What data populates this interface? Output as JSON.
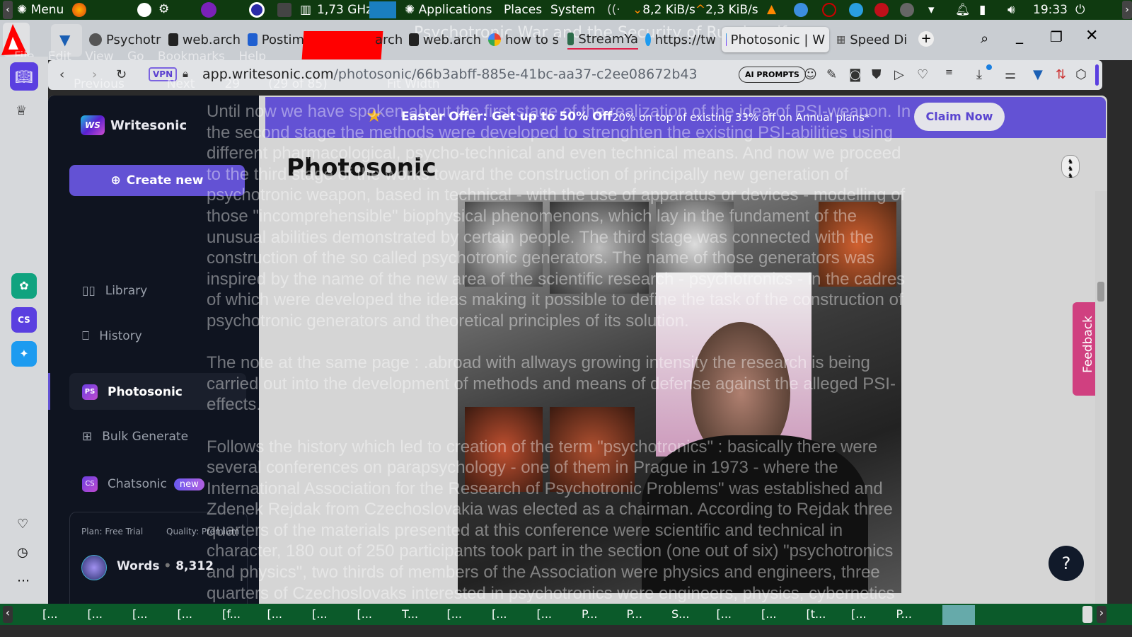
{
  "top_panel": {
    "menu": "Menu",
    "cpu": "1,73 GHz",
    "applications": "Applications",
    "places": "Places",
    "system": "System",
    "net_down": "8,2 KiB/s",
    "net_up": "2,3 KiB/s",
    "clock": "19:33"
  },
  "window_title_ghost": "Psychotronic War and the Security of Russia.pdf",
  "pdf_menu_ghost": [
    "File",
    "Edit",
    "View",
    "Go",
    "Bookmarks",
    "Help"
  ],
  "pdf_toolbar_ghost": {
    "previous": "Previous",
    "next": "Next",
    "page": "29",
    "page_of": "(29 of 85)",
    "zoom": "Fit Width"
  },
  "tabs": [
    {
      "label": "Psychotr"
    },
    {
      "label": "web.arch"
    },
    {
      "label": "Postim"
    },
    {
      "label": "arch"
    },
    {
      "label": "web.arch"
    },
    {
      "label": "how to s"
    },
    {
      "label": "StreamYa"
    },
    {
      "label": "https://tw"
    },
    {
      "label": "Photosonic | W",
      "active": true
    },
    {
      "label": "Speed Di"
    }
  ],
  "address": {
    "vpn": "VPN",
    "host": "app.writesonic.com",
    "path": "/photosonic/66b3abff-885e-41bc-aa37-c2ee08672b43",
    "ai_prompts": "AI PROMPTS"
  },
  "app": {
    "brand": "Writesonic",
    "logo_text": "WS",
    "create_new": "Create new",
    "nav": [
      {
        "label": "Library"
      },
      {
        "label": "History"
      },
      {
        "label": "Photosonic",
        "active": true
      },
      {
        "label": "Bulk Generate"
      },
      {
        "label": "Chatsonic",
        "badge": "new"
      }
    ],
    "plan": "Plan: Free Trial",
    "quality": "Quality: Premium",
    "words_label": "Words",
    "words_count": "8,312",
    "banner": {
      "title": "Easter Offer: Get up to 50% Off",
      "sub": "20% on top of existing 33% off on Annual plans*",
      "cta": "Claim Now"
    },
    "page_title": "Photosonic",
    "feedback": "Feedback"
  },
  "ghost_text": "Until now we have spoken about the first stage of the realization of the idea of PSI-weapon. In\nthe second stage the methods were developed to strenghten the existing PSI-abilities using\ndifferent pharmacological, psycho-technical and even technical means. And now we proceed\nto the third stage of the works toward the construction of principally new generation of\npsychotronic weapon, based in technical - with the use of apparatus or devices - modelling of\nthose \"incomprehensible\" biophysical phenomenons, which lay in the fundament of the\nunusual abilities demonstrated by certain people. The third stage was connected with the\nconstruction of the so called psychotronic generators. The name of those generators was\ninspired by the name of the new area of the scientific research - psychotronics - in the cadres\nof which were developed the ideas making it possible to define the task of the construction of\npsychotronic generators and theoretical principles of its solution.\n\nThe note at the same page : .abroad with allways growing intensity the research is being\ncarried out into the development of methods and means of defense against the alleged PSI-\neffects.\n\nFollows the history which led to creation of the term \"psychotronics\" : basically there were\nseveral conferences on parapsychology - one of them in Prague in 1973 - where the\nInternational Association for the Research of Psychotronic Problems\" was established and\nZdenek Rejdak from Czechoslovakia was elected as a chairman. According to Rejdak three\nquarters of the materials presented at this conference were scientific and technical in\ncharacter, 180 out of 250 participants took part in the section (one out of six) \"psychotronics\nand physics\", two thirds of members of the Association were physics and engineers, three\nquarters of Czechoslovaks interested in psychotronics were engineers, physics, cybernetics",
  "taskbar": [
    "[...",
    "[...",
    "[...",
    "[...",
    "[f...",
    "[...",
    "[...",
    "[...",
    "T...",
    "[...",
    "[...",
    "[...",
    "P...",
    "P...",
    "S...",
    "[...",
    "[...",
    "[t...",
    "[...",
    "P..."
  ]
}
